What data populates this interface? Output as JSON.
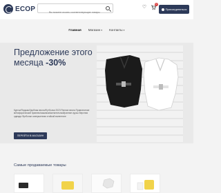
{
  "header": {
    "brand": "ECOP",
    "search_placeholder": "Вы можете искать соответствующие товары",
    "cart_count": "0",
    "profile_label": "Присоединиться"
  },
  "nav": {
    "items": [
      {
        "label": "Главная"
      },
      {
        "label": "Магазин"
      },
      {
        "label": "Контакты"
      }
    ]
  },
  "hero": {
    "title_line1": "Предложение этого",
    "title_line2_prefix": "месяца ",
    "title_line2_bold": "-30%",
    "description": "Куртки/Пиджак/Удобная весна/Футболки 2023 Ранние весна Привлечение метафорический привлек/зажимом/желательный/ранние курсы Верхняя одежда Футболки совершенная стойкой валентине",
    "button_label": "ПЕРЕЙТИ В МАГАЗИН"
  },
  "section": {
    "title": "Самые продаваемые товары"
  },
  "colors": {
    "brand": "#2d3a59",
    "badge": "#d83b3b",
    "card_yellow": "#f1d34a"
  }
}
